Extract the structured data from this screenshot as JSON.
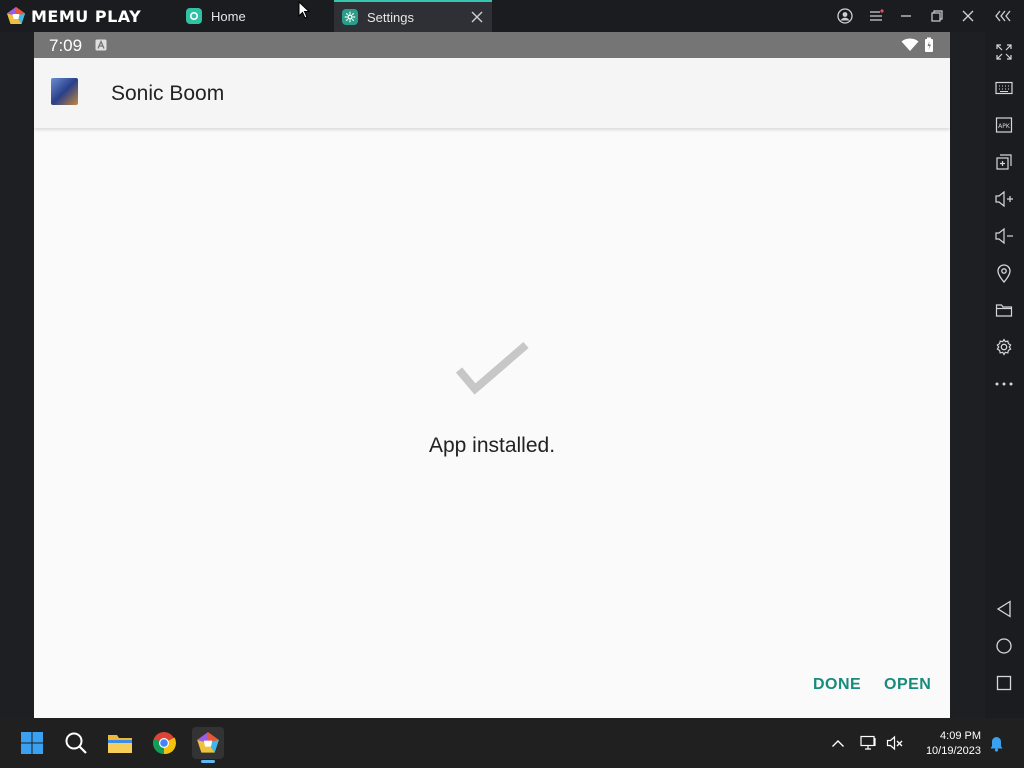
{
  "app": {
    "brand": "MEMU PLAY",
    "tabs": [
      {
        "label": "Home"
      },
      {
        "label": "Settings"
      }
    ]
  },
  "android": {
    "status": {
      "time": "7:09"
    },
    "appbar": {
      "title": "Sonic Boom"
    },
    "message": "App installed.",
    "actions": {
      "done": "DONE",
      "open": "OPEN"
    }
  },
  "taskbar": {
    "time": "4:09 PM",
    "date": "10/19/2023"
  },
  "colors": {
    "accent": "#178b7c",
    "tab_accent": "#35c6b0",
    "statusbar": "#757575",
    "check": "#c7c7c7"
  }
}
